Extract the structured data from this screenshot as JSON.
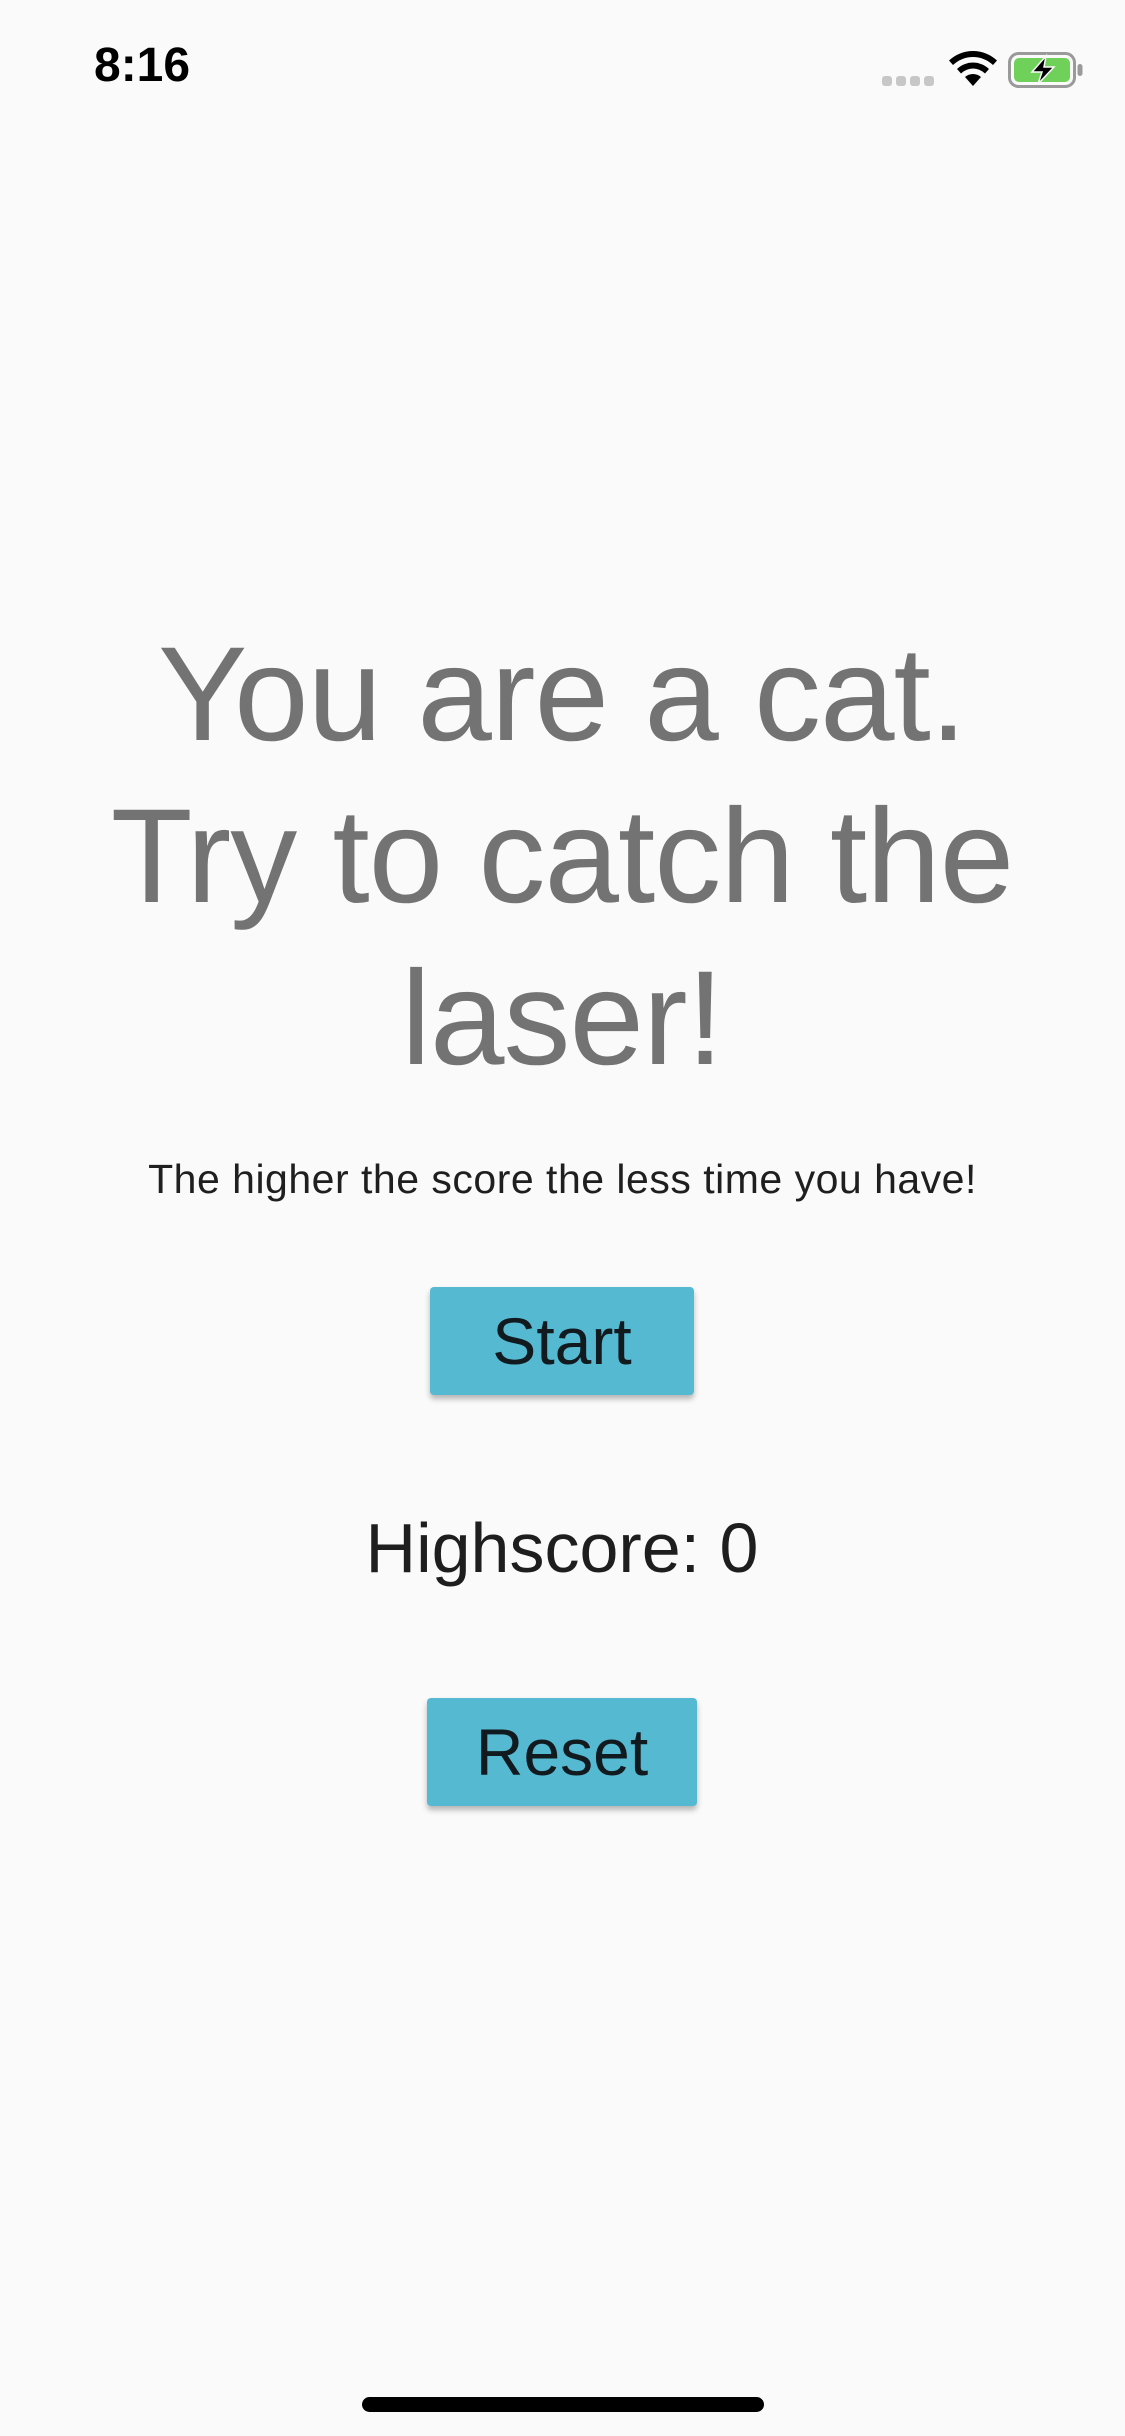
{
  "status_bar": {
    "time": "8:16",
    "icons": [
      "cellular-signal-icon",
      "wifi-icon",
      "battery-charging-icon"
    ],
    "battery_color": "#6fd15a"
  },
  "main": {
    "headline_line1": "You are a cat.",
    "headline_line2": "Try to catch the",
    "headline_line3": "laser!",
    "subline": "The higher the score the less time you have!",
    "start_label": "Start",
    "highscore_label": "Highscore: 0",
    "reset_label": "Reset"
  },
  "colors": {
    "background": "#fafafa",
    "button": "#56b9d2",
    "headline_text": "#737373"
  }
}
